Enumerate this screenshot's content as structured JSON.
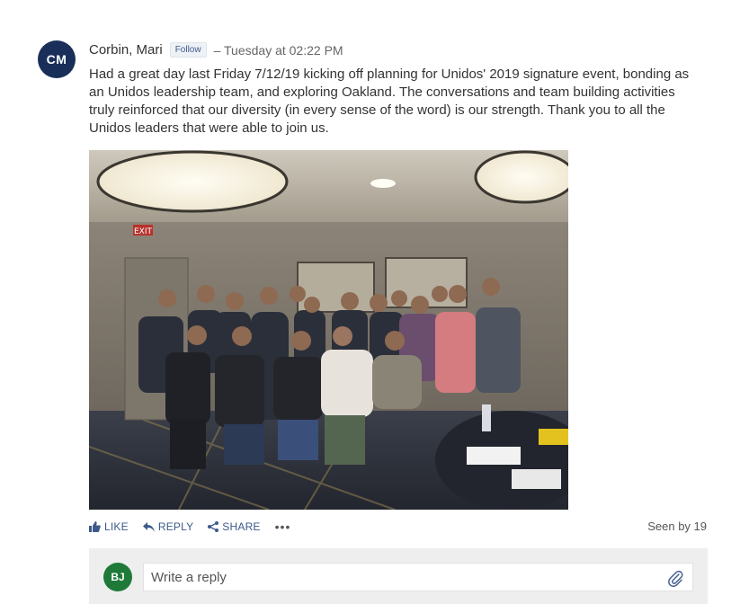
{
  "post": {
    "avatar_initials": "CM",
    "author": "Corbin, Mari",
    "follow_label": "Follow",
    "timestamp": "– Tuesday at 02:22 PM",
    "body": "Had a great day last Friday 7/12/19 kicking off planning for Unidos' 2019 signature event, bonding as an Unidos leadership team, and exploring Oakland.  The conversations and team building activities truly reinforced that our diversity (in every sense of the word) is our strength.  Thank you to all the Unidos leaders that were able to join us.",
    "photo_sign": "EXIT"
  },
  "actions": {
    "like": "LIKE",
    "reply": "REPLY",
    "share": "SHARE",
    "more": "•••",
    "seen": "Seen by 19"
  },
  "reply_box": {
    "avatar_initials": "BJ",
    "placeholder": "Write a reply"
  },
  "colors": {
    "author_avatar": "#1a2e5a",
    "reply_avatar": "#1f7a3a",
    "action_link": "#3c5a8a"
  }
}
